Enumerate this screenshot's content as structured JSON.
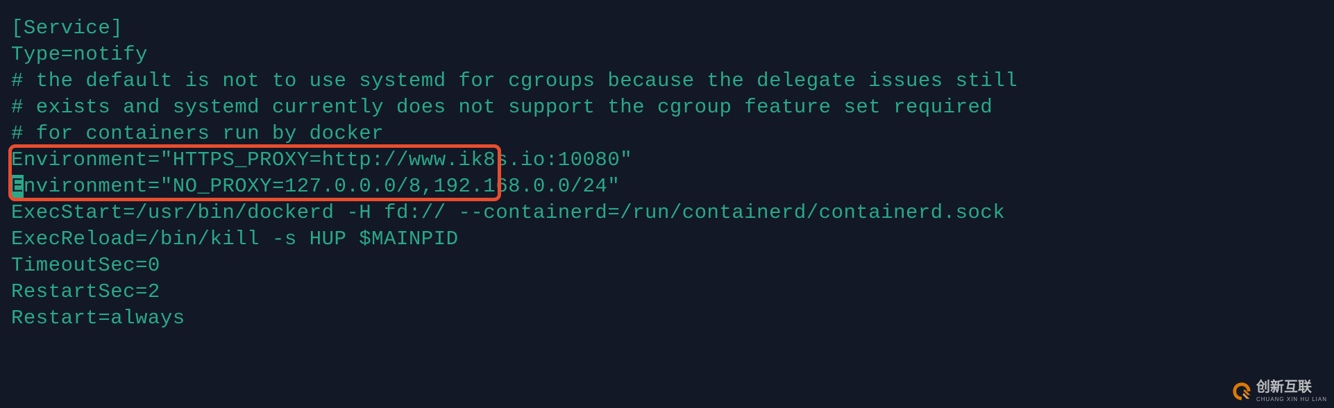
{
  "config": {
    "lines": [
      "[Service]",
      "Type=notify",
      "# the default is not to use systemd for cgroups because the delegate issues still",
      "# exists and systemd currently does not support the cgroup feature set required",
      "# for containers run by docker",
      "Environment=\"HTTPS_PROXY=http://www.ik8s.io:10080\"",
      "Environment=\"NO_PROXY=127.0.0.0/8,192.168.0.0/24\"",
      "ExecStart=/usr/bin/dockerd -H fd:// --containerd=/run/containerd/containerd.sock",
      "ExecReload=/bin/kill -s HUP $MAINPID",
      "TimeoutSec=0",
      "RestartSec=2",
      "Restart=always"
    ],
    "cursor_line_index": 6,
    "cursor_col": 0
  },
  "watermark": {
    "zh": "创新互联",
    "en": "CHUANG XIN HU LIAN"
  }
}
